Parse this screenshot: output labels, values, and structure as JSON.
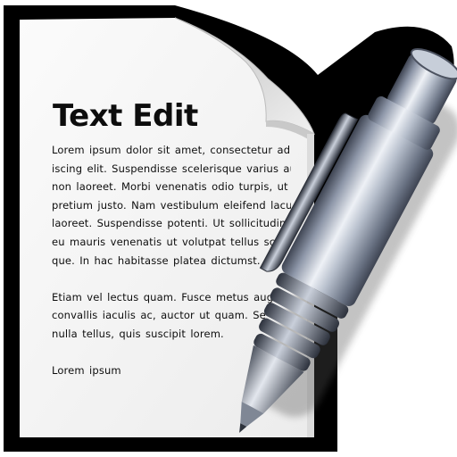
{
  "icon": {
    "name": "text-edit-app-icon",
    "title": "Text Edit",
    "paragraph_1_lines": [
      "Lorem ipsum dolor sit amet, consectetur adip",
      "iscing elit. Suspendisse scelerisque varius augue",
      "non laoreet. Morbi venenatis odio turpis, ut",
      "pretium justo. Nam vestibulum eleifend lacus s",
      "laoreet. Suspendisse potenti. Ut sollicitudin ligul",
      "eu mauris venenatis ut volutpat tellus scele",
      "que. In hac habitasse platea dictumst."
    ],
    "paragraph_2_lines": [
      "Etiam vel lectus quam. Fusce metus augu",
      "convallis iaculis ac, auctor ut quam. Se",
      "nulla tellus, quis suscipit lorem."
    ],
    "signature": "Lorem ipsum",
    "colors": {
      "outline": "#000000",
      "paper": "#f6f6f6",
      "page_curl": "#e4e4e4",
      "text": "#0d0d0d",
      "pen_metal_light": "#eef1f6",
      "pen_metal_mid": "#9aa3b3",
      "pen_metal_dark": "#3e4452"
    }
  }
}
